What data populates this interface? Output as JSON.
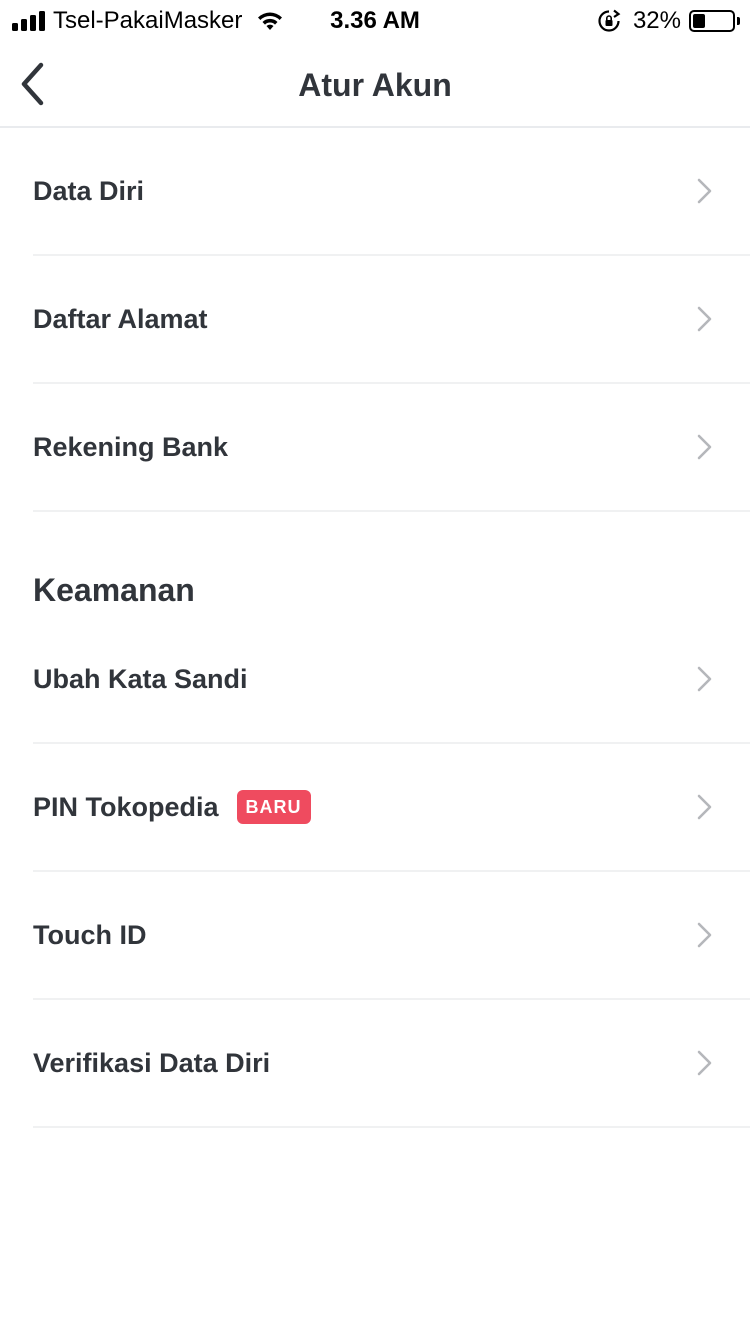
{
  "status_bar": {
    "carrier": "Tsel-PakaiMasker",
    "time": "3.36 AM",
    "battery_percent": "32%",
    "battery_level": 0.32
  },
  "nav": {
    "title": "Atur Akun",
    "back_icon": "chevron-left-icon"
  },
  "account_items": [
    {
      "label": "Data Diri"
    },
    {
      "label": "Daftar Alamat"
    },
    {
      "label": "Rekening Bank"
    }
  ],
  "security": {
    "title": "Keamanan",
    "items": [
      {
        "label": "Ubah Kata Sandi"
      },
      {
        "label": "PIN Tokopedia",
        "badge": "BARU"
      },
      {
        "label": "Touch ID"
      },
      {
        "label": "Verifikasi Data Diri"
      }
    ]
  },
  "colors": {
    "text": "#31353b",
    "badge": "#ef4b5f",
    "chevron": "#b5b7bb",
    "divider": "#f0f1f2"
  }
}
